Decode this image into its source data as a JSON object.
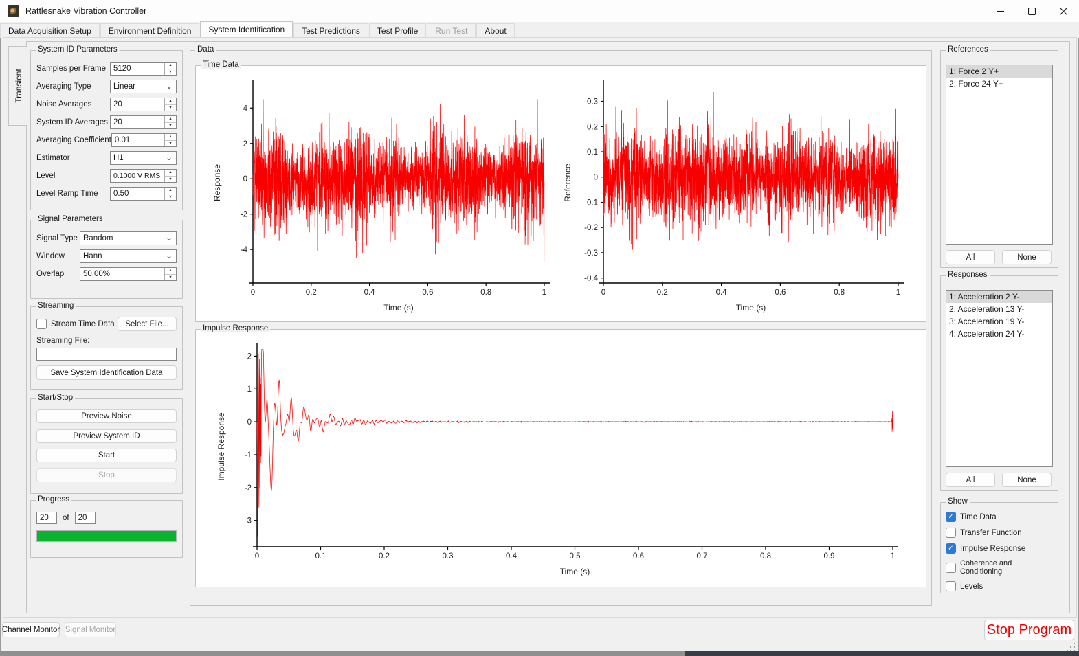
{
  "window": {
    "title": "Rattlesnake Vibration Controller"
  },
  "tabs": [
    {
      "label": "Data Acquisition Setup",
      "state": "normal"
    },
    {
      "label": "Environment Definition",
      "state": "normal"
    },
    {
      "label": "System Identification",
      "state": "selected"
    },
    {
      "label": "Test Predictions",
      "state": "normal"
    },
    {
      "label": "Test Profile",
      "state": "normal"
    },
    {
      "label": "Run Test",
      "state": "disabled"
    },
    {
      "label": "About",
      "state": "normal"
    }
  ],
  "side_tab": "Transient",
  "sysid": {
    "title": "System ID Parameters",
    "fields": [
      {
        "label": "Samples per Frame",
        "value": "5120",
        "type": "spin"
      },
      {
        "label": "Averaging Type",
        "value": "Linear",
        "type": "select"
      },
      {
        "label": "Noise Averages",
        "value": "20",
        "type": "spin"
      },
      {
        "label": "System ID Averages",
        "value": "20",
        "type": "spin"
      },
      {
        "label": "Averaging Coefficient",
        "value": "0.01",
        "type": "spin"
      },
      {
        "label": "Estimator",
        "value": "H1",
        "type": "select"
      },
      {
        "label": "Level",
        "value": "0.1000 V RMS",
        "type": "spin"
      },
      {
        "label": "Level Ramp Time",
        "value": "0.50",
        "type": "spin"
      }
    ]
  },
  "signal": {
    "title": "Signal Parameters",
    "fields": [
      {
        "label": "Signal Type",
        "value": "Random",
        "type": "select"
      },
      {
        "label": "Window",
        "value": "Hann",
        "type": "select"
      },
      {
        "label": "Overlap",
        "value": "50.00%",
        "type": "spin"
      }
    ]
  },
  "streaming": {
    "title": "Streaming",
    "checkbox_label": "Stream Time Data",
    "checkbox_checked": false,
    "select_file_label": "Select File...",
    "file_label": "Streaming File:",
    "file_value": "",
    "save_label": "Save System Identification Data"
  },
  "startstop": {
    "title": "Start/Stop",
    "buttons": [
      {
        "label": "Preview Noise",
        "enabled": true
      },
      {
        "label": "Preview System ID",
        "enabled": true
      },
      {
        "label": "Start",
        "enabled": true
      },
      {
        "label": "Stop",
        "enabled": false
      }
    ]
  },
  "progress": {
    "title": "Progress",
    "current": "20",
    "of_label": "of",
    "total": "20",
    "percent": 100,
    "bar_color": "#0cb32e"
  },
  "data_panel": {
    "title": "Data",
    "time_data_title": "Time Data",
    "impulse_title": "Impulse Response"
  },
  "references": {
    "title": "References",
    "items": [
      {
        "label": "1: Force 2 Y+",
        "selected": true
      },
      {
        "label": "2: Force 24 Y+",
        "selected": false
      }
    ],
    "all_label": "All",
    "none_label": "None"
  },
  "responses": {
    "title": "Responses",
    "items": [
      {
        "label": "1: Acceleration 2 Y-",
        "selected": true
      },
      {
        "label": "2: Acceleration 13 Y-",
        "selected": false
      },
      {
        "label": "3: Acceleration 19 Y-",
        "selected": false
      },
      {
        "label": "4: Acceleration 24 Y-",
        "selected": false
      }
    ],
    "all_label": "All",
    "none_label": "None"
  },
  "show": {
    "title": "Show",
    "items": [
      {
        "label": "Time Data",
        "checked": true
      },
      {
        "label": "Transfer Function",
        "checked": false
      },
      {
        "label": "Impulse Response",
        "checked": true
      },
      {
        "label": "Coherence and Conditioning",
        "checked": false
      },
      {
        "label": "Levels",
        "checked": false
      }
    ]
  },
  "statusbar": {
    "channel_monitor": "Channel Monitor",
    "signal_monitor": "Signal Monitor",
    "stop_program": "Stop Program",
    "stop_color": "#f20000"
  },
  "chart_data": [
    {
      "type": "line",
      "name": "response-time-history",
      "title": "",
      "xlabel": "Time (s)",
      "ylabel": "Response",
      "xlim": [
        0,
        1
      ],
      "ylim": [
        -5.9,
        5.45
      ],
      "xticks": [
        0,
        0.2,
        0.4,
        0.6,
        0.8,
        1
      ],
      "xtick_labels": [
        "0",
        "0.2",
        "0.4",
        "0.6",
        "0.8",
        "1"
      ],
      "yticks": [
        -4,
        -2,
        0,
        2,
        4
      ],
      "ytick_labels": [
        "-4",
        "-2",
        "0",
        "2",
        "4"
      ],
      "line_color": "#f80000",
      "grid": false,
      "description": "Dense zero-mean Gaussian random response time history over 0-1 s, rms ~1.25, peaks ~ +5 / -5.5",
      "signal": {
        "kind": "gaussian-noise",
        "sigma": 1.22,
        "seed": 101,
        "points": 2600,
        "clamp": [
          -5.5,
          5.0
        ],
        "env": [
          0.22,
          0.15,
          0.1
        ]
      }
    },
    {
      "type": "line",
      "name": "reference-time-history",
      "title": "",
      "xlabel": "Time (s)",
      "ylabel": "Reference",
      "xlim": [
        0,
        1
      ],
      "ylim": [
        -0.42,
        0.375
      ],
      "xticks": [
        0,
        0.2,
        0.4,
        0.6,
        0.8,
        1
      ],
      "xtick_labels": [
        "0",
        "0.2",
        "0.4",
        "0.6",
        "0.8",
        "1"
      ],
      "yticks": [
        -0.4,
        -0.3,
        -0.2,
        -0.1,
        0,
        0.1,
        0.2,
        0.3
      ],
      "ytick_labels": [
        "-0.4",
        "-0.3",
        "-0.2",
        "-0.1",
        "0",
        "0.1",
        "0.2",
        "0.3"
      ],
      "line_color": "#f80000",
      "grid": false,
      "description": "Dense zero-mean Gaussian random reference (drive) time history over 0-1 s, rms ~0.085, peaks ~ +0.35 / -0.38",
      "signal": {
        "kind": "gaussian-noise",
        "sigma": 0.085,
        "seed": 202,
        "points": 2600,
        "clamp": [
          -0.38,
          0.35
        ],
        "env": [
          0.12,
          0.1,
          0.06
        ]
      }
    },
    {
      "type": "line",
      "name": "impulse-response",
      "title": "",
      "xlabel": "Time (s)",
      "ylabel": "Impulse Response",
      "xlim": [
        0,
        1
      ],
      "ylim": [
        -3.8,
        2.3
      ],
      "xticks": [
        0,
        0.1,
        0.2,
        0.3,
        0.4,
        0.5,
        0.6,
        0.7,
        0.8,
        0.9,
        1
      ],
      "xtick_labels": [
        "0",
        "0.1",
        "0.2",
        "0.3",
        "0.4",
        "0.5",
        "0.6",
        "0.7",
        "0.8",
        "0.9",
        "1"
      ],
      "yticks": [
        -3,
        -2,
        -1,
        0,
        1,
        2
      ],
      "ytick_labels": [
        "-3",
        "-2",
        "-1",
        "0",
        "1",
        "2"
      ],
      "line_color": "#f80000",
      "grid": false,
      "description": "Decaying oscillatory impulse response: initial spike to -3.5 then +2.05 near t=0, ringing decays to ~0 by t=0.25, flat near zero afterwards with a small wrap-around spike at t=1",
      "signal": {
        "kind": "decaying-impulse",
        "seed": 303,
        "points": 3000,
        "clamp": [
          -3.6,
          2.2
        ],
        "noise_floor": 0.005,
        "components": [
          {
            "amp": 1.9,
            "freq": 48,
            "phase": 4.4,
            "decay": 28
          },
          {
            "amp": 2.1,
            "freq": 110,
            "phase": 2.0,
            "decay": 45
          },
          {
            "amp": 0.55,
            "freq": 26,
            "phase": 1.0,
            "decay": 18
          },
          {
            "amp": 0.35,
            "freq": 150,
            "phase": 0.5,
            "decay": 12
          },
          {
            "amp": 0.1,
            "freq": 210,
            "phase": 0.0,
            "decay": 9
          }
        ],
        "start_spike": [
          0,
          -0.7,
          -2.2,
          -3.5,
          -1.1,
          1.4,
          2.05,
          0.5,
          -1.7,
          -2.6,
          0.7,
          1.9,
          -0.4,
          -2.0,
          1.6,
          -1.5,
          1.35,
          -1.25,
          1.15,
          -1.05
        ],
        "end_spike": [
          0.1,
          -0.3,
          0.33,
          -0.22,
          0.08
        ]
      }
    }
  ]
}
